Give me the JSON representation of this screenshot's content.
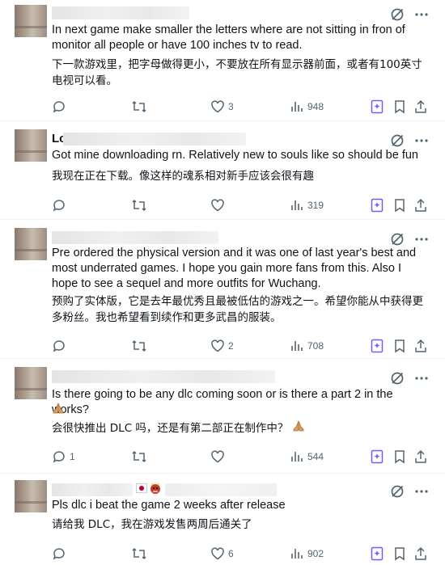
{
  "posts": [
    {
      "handle": "",
      "text": "In next game make smaller the letters where are not sitting in fron of monitor all people or have 100 inches tv to read.",
      "translation": "下一款游戏里，把字母做得更小，不要放在所有显示器前面，或者有100英寸电视可以看。",
      "replies": "",
      "reposts": "",
      "likes": "3",
      "views": "948"
    },
    {
      "handle": "Lc",
      "text": "Got mine downloading rn. Relatively new to souls like so should be fun",
      "translation": "我现在正在下载。像这样的魂系相对新手应该会很有趣",
      "replies": "",
      "reposts": "",
      "likes": "",
      "views": "319"
    },
    {
      "handle": "",
      "text": "Pre ordered the physical version and it was one of last year's best and most underrated games. I hope you gain more fans from this. Also I hope to see a sequel and more outfits for Wuchang.",
      "translation": "预购了实体版，它是去年最优秀且最被低估的游戏之一。希望你能从中获得更多粉丝。我也希望看到续作和更多武昌的服装。",
      "replies": "",
      "reposts": "",
      "likes": "2",
      "views": "708"
    },
    {
      "handle": "",
      "text": "Is there going to be any dlc coming soon or is there a part 2 in the works?",
      "translation": "会很快推出 DLC 吗，还是有第二部正在制作中？",
      "replies": "1",
      "reposts": "",
      "likes": "",
      "views": "544"
    },
    {
      "handle": "",
      "text": "Pls dlc i beat the game 2 weeks after release",
      "translation": "请给我 DLC，我在游戏发售两周后通关了",
      "replies": "",
      "reposts": "",
      "likes": "6",
      "views": "902"
    }
  ],
  "icons": {
    "grok": "grok-icon",
    "more": "more-icon",
    "reply": "reply-icon",
    "repost": "repost-icon",
    "like": "like-icon",
    "views": "views-icon",
    "grok_actions": "grok-actions-icon",
    "bookmark": "bookmark-icon",
    "share": "share-icon",
    "folded_hands": "folded-hands-emoji"
  },
  "colors": {
    "text": "#0f1419",
    "muted": "#536471",
    "divider": "#eff3f4"
  }
}
